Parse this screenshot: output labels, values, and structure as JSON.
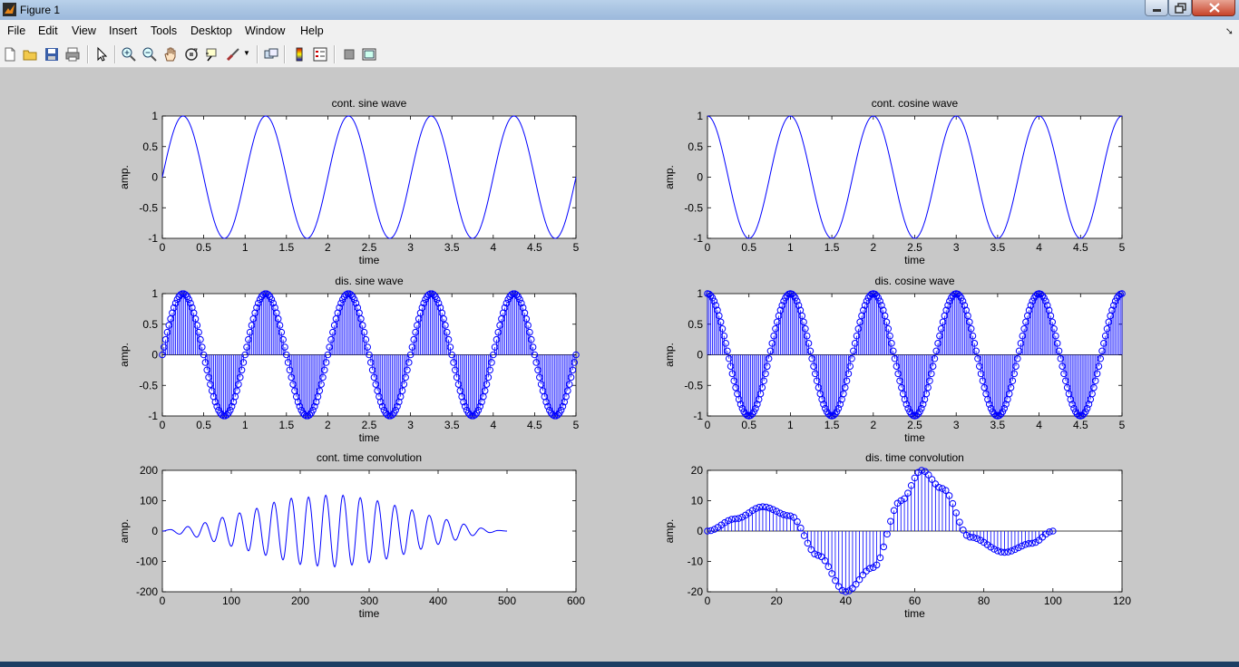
{
  "window": {
    "title": "Figure 1"
  },
  "menu": [
    "File",
    "Edit",
    "View",
    "Insert",
    "Tools",
    "Desktop",
    "Window",
    "Help"
  ],
  "toolbar": [
    {
      "name": "new-figure-icon"
    },
    {
      "name": "open-file-icon"
    },
    {
      "name": "save-icon"
    },
    {
      "name": "print-icon"
    },
    {
      "name": "pointer-icon"
    },
    {
      "name": "zoom-in-icon"
    },
    {
      "name": "zoom-out-icon"
    },
    {
      "name": "pan-hand-icon"
    },
    {
      "name": "rotate-3d-icon"
    },
    {
      "name": "data-cursor-icon"
    },
    {
      "name": "brush-icon"
    },
    {
      "name": "link-plot-icon"
    },
    {
      "name": "colorbar-icon"
    },
    {
      "name": "legend-icon"
    },
    {
      "name": "hide-plot-tools-icon"
    },
    {
      "name": "show-plot-tools-icon"
    }
  ],
  "colors": {
    "line": "#0000ff",
    "axes_bg": "#ffffff",
    "figure_bg": "#c8c8c8"
  },
  "chart_data": [
    {
      "id": "cont-sine",
      "type": "line",
      "title": "cont. sine wave",
      "xlabel": "time",
      "ylabel": "amp.",
      "xlim": [
        0,
        5
      ],
      "ylim": [
        -1,
        1
      ],
      "xticks": [
        0,
        0.5,
        1,
        1.5,
        2,
        2.5,
        3,
        3.5,
        4,
        4.5,
        5
      ],
      "xtick_labels": [
        "0",
        "0.5",
        "1",
        "1.5",
        "2",
        "2.5",
        "3",
        "3.5",
        "4",
        "4.5",
        "5"
      ],
      "yticks": [
        -1,
        -0.5,
        0,
        0.5,
        1
      ],
      "ytick_labels": [
        "-1",
        "-0.5",
        "0",
        "0.5",
        "1"
      ],
      "series": [
        {
          "function": "sin",
          "frequency_hz": 1,
          "x_start": 0,
          "x_end": 5
        }
      ]
    },
    {
      "id": "cont-cosine",
      "type": "line",
      "title": "cont. cosine wave",
      "xlabel": "time",
      "ylabel": "amp.",
      "xlim": [
        0,
        5
      ],
      "ylim": [
        -1,
        1
      ],
      "xticks": [
        0,
        0.5,
        1,
        1.5,
        2,
        2.5,
        3,
        3.5,
        4,
        4.5,
        5
      ],
      "xtick_labels": [
        "0",
        "0.5",
        "1",
        "1.5",
        "2",
        "2.5",
        "3",
        "3.5",
        "4",
        "4.5",
        "5"
      ],
      "yticks": [
        -1,
        -0.5,
        0,
        0.5,
        1
      ],
      "ytick_labels": [
        "-1",
        "-0.5",
        "0",
        "0.5",
        "1"
      ],
      "series": [
        {
          "function": "cos",
          "frequency_hz": 1,
          "x_start": 0,
          "x_end": 5
        }
      ]
    },
    {
      "id": "dis-sine",
      "type": "stem",
      "title": "dis. sine wave",
      "xlabel": "time",
      "ylabel": "amp.",
      "xlim": [
        0,
        5
      ],
      "ylim": [
        -1,
        1
      ],
      "xticks": [
        0,
        0.5,
        1,
        1.5,
        2,
        2.5,
        3,
        3.5,
        4,
        4.5,
        5
      ],
      "xtick_labels": [
        "0",
        "0.5",
        "1",
        "1.5",
        "2",
        "2.5",
        "3",
        "3.5",
        "4",
        "4.5",
        "5"
      ],
      "yticks": [
        -1,
        -0.5,
        0,
        0.5,
        1
      ],
      "ytick_labels": [
        "-1",
        "-0.5",
        "0",
        "0.5",
        "1"
      ],
      "series": [
        {
          "function": "sin",
          "frequency_hz": 1,
          "x_start": 0,
          "x_end": 5,
          "sample_step": 0.02
        }
      ]
    },
    {
      "id": "dis-cosine",
      "type": "stem",
      "title": "dis. cosine wave",
      "xlabel": "time",
      "ylabel": "amp.",
      "xlim": [
        0,
        5
      ],
      "ylim": [
        -1,
        1
      ],
      "xticks": [
        0,
        0.5,
        1,
        1.5,
        2,
        2.5,
        3,
        3.5,
        4,
        4.5,
        5
      ],
      "xtick_labels": [
        "0",
        "0.5",
        "1",
        "1.5",
        "2",
        "2.5",
        "3",
        "3.5",
        "4",
        "4.5",
        "5"
      ],
      "yticks": [
        -1,
        -0.5,
        0,
        0.5,
        1
      ],
      "ytick_labels": [
        "-1",
        "-0.5",
        "0",
        "0.5",
        "1"
      ],
      "series": [
        {
          "function": "cos",
          "frequency_hz": 1,
          "x_start": 0,
          "x_end": 5,
          "sample_step": 0.02
        }
      ]
    },
    {
      "id": "cont-conv",
      "type": "line",
      "title": "cont. time convolution",
      "xlabel": "time",
      "ylabel": "amp.",
      "xlim": [
        0,
        600
      ],
      "ylim": [
        -200,
        200
      ],
      "xticks": [
        0,
        100,
        200,
        300,
        400,
        500,
        600
      ],
      "xtick_labels": [
        "0",
        "100",
        "200",
        "300",
        "400",
        "500",
        "600"
      ],
      "yticks": [
        -200,
        -100,
        0,
        100,
        200
      ],
      "ytick_labels": [
        "-200",
        "-100",
        "0",
        "100",
        "200"
      ],
      "series": [
        {
          "x": [
            0,
            12,
            25,
            37,
            50,
            62,
            75,
            87,
            100,
            112,
            125,
            137,
            150,
            162,
            175,
            187,
            200,
            212,
            225,
            237,
            250,
            262,
            275,
            287,
            300,
            312,
            325,
            337,
            350,
            362,
            375,
            387,
            400,
            412,
            425,
            437,
            450,
            462,
            475,
            487,
            500
          ],
          "y": [
            0,
            5,
            -10,
            15,
            -20,
            28,
            -35,
            45,
            -50,
            60,
            -65,
            75,
            -80,
            95,
            -95,
            108,
            -110,
            112,
            -115,
            118,
            -118,
            118,
            -112,
            110,
            -104,
            100,
            -92,
            85,
            -77,
            70,
            -60,
            52,
            -44,
            38,
            -30,
            23,
            -15,
            10,
            -5,
            2,
            0
          ]
        }
      ]
    },
    {
      "id": "dis-conv",
      "type": "stem",
      "title": "dis. time convolution",
      "xlabel": "time",
      "ylabel": "amp.",
      "xlim": [
        0,
        120
      ],
      "ylim": [
        -20,
        20
      ],
      "xticks": [
        0,
        20,
        40,
        60,
        80,
        100,
        120
      ],
      "xtick_labels": [
        "0",
        "20",
        "40",
        "60",
        "80",
        "100",
        "120"
      ],
      "yticks": [
        -20,
        -10,
        0,
        10,
        20
      ],
      "ytick_labels": [
        "-20",
        "-10",
        "0",
        "10",
        "20"
      ],
      "series": [
        {
          "x": [
            0,
            8,
            16,
            24,
            32,
            40,
            48,
            56,
            62,
            68,
            76,
            86,
            94,
            100
          ],
          "y": [
            0,
            4,
            8,
            5,
            -8,
            -20,
            -12,
            10,
            20,
            14,
            -2,
            -7,
            -4,
            0
          ]
        }
      ]
    }
  ]
}
